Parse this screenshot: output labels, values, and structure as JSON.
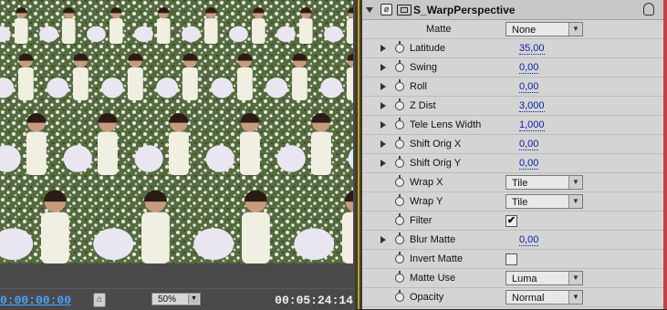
{
  "monitor": {
    "timecode_current": "0:00:00:00",
    "timecode_duration": "00:05:24:14",
    "zoom": "50%",
    "snap_icon": "film-snap-icon"
  },
  "effect": {
    "name": "S_WarpPerspective",
    "matte_label": "Matte",
    "matte_value": "None",
    "params": [
      {
        "label": "Latitude",
        "value": "35,00",
        "type": "value",
        "expand": true
      },
      {
        "label": "Swing",
        "value": "0,00",
        "type": "value",
        "expand": true
      },
      {
        "label": "Roll",
        "value": "0,00",
        "type": "value",
        "expand": true
      },
      {
        "label": "Z Dist",
        "value": "3,000",
        "type": "value",
        "expand": true
      },
      {
        "label": "Tele Lens Width",
        "value": "1,000",
        "type": "value",
        "expand": true
      },
      {
        "label": "Shift Orig X",
        "value": "0,00",
        "type": "value",
        "expand": true
      },
      {
        "label": "Shift Orig Y",
        "value": "0,00",
        "type": "value",
        "expand": true
      },
      {
        "label": "Wrap X",
        "value": "Tile",
        "type": "dropdown",
        "expand": false
      },
      {
        "label": "Wrap Y",
        "value": "Tile",
        "type": "dropdown",
        "expand": false
      },
      {
        "label": "Filter",
        "value": "✔",
        "type": "checkbox",
        "expand": false
      },
      {
        "label": "Blur Matte",
        "value": "0,00",
        "type": "value",
        "expand": true
      },
      {
        "label": "Invert Matte",
        "value": "",
        "type": "checkbox",
        "expand": false
      },
      {
        "label": "Matte Use",
        "value": "Luma",
        "type": "dropdown",
        "expand": false
      },
      {
        "label": "Opacity",
        "value": "Normal",
        "type": "dropdown",
        "expand": false
      }
    ]
  },
  "colors": {
    "value_blue": "#0b1fa8",
    "timecode_blue": "#4aa3ff",
    "accent_orange": "#c8a000"
  }
}
